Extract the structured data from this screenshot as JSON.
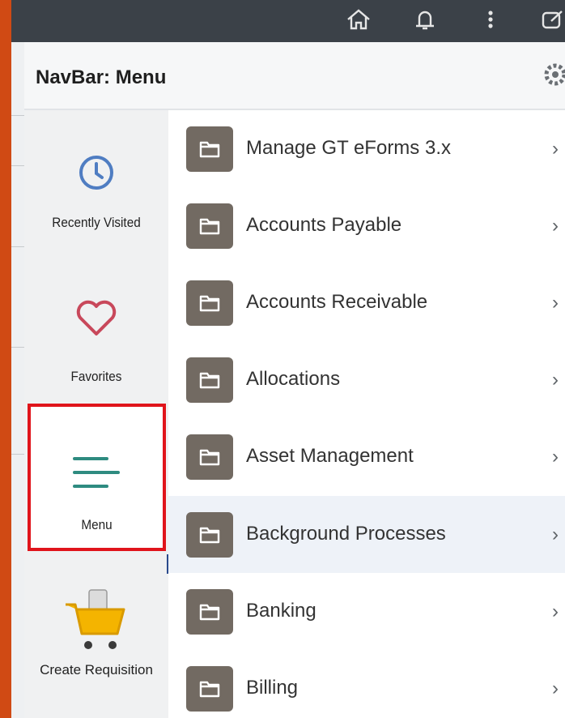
{
  "topbar": {
    "icons": [
      "home-icon",
      "bell-icon",
      "more-vertical-icon",
      "external-link-icon"
    ]
  },
  "navbar": {
    "title": "NavBar: Menu",
    "settings_icon": "gear-icon"
  },
  "sidebar": {
    "items": [
      {
        "label": "Recently Visited",
        "icon": "clock-icon"
      },
      {
        "label": "Favorites",
        "icon": "heart-icon"
      },
      {
        "label": "Menu",
        "icon": "hamburger-icon",
        "selected": true
      },
      {
        "label": "Create Requisition",
        "icon": "shopping-cart-icon"
      }
    ]
  },
  "menu": {
    "items": [
      {
        "label": "Manage GT eForms 3.x"
      },
      {
        "label": "Accounts Payable"
      },
      {
        "label": "Accounts Receivable"
      },
      {
        "label": "Allocations"
      },
      {
        "label": "Asset Management"
      },
      {
        "label": "Background Processes",
        "highlighted": true
      },
      {
        "label": "Banking"
      },
      {
        "label": "Billing"
      }
    ]
  },
  "colors": {
    "topbar": "#3b4148",
    "selection_border": "#e0141b",
    "folder_tile": "#726a62",
    "clock_blue": "#4f7dc2",
    "heart_red": "#c8485b",
    "menu_teal": "#2e8b80",
    "cart_yellow": "#f4b400"
  }
}
